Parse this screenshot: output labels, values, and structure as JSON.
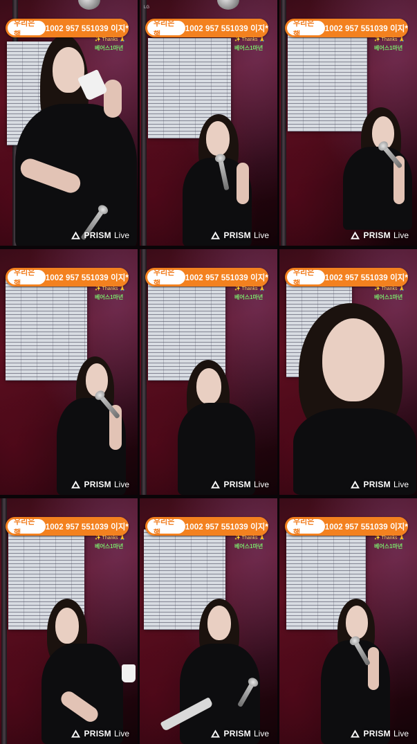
{
  "overlay": {
    "bank_label": "우리은행",
    "account": "1002 957 551039 이지",
    "thanks": "Thanks",
    "subtitle": "베어스1마년",
    "prism_brand": "PRISM",
    "prism_live": "Live"
  },
  "colors": {
    "banner": "#f3811f",
    "bank_text": "#f07a1a",
    "subtitle": "#7be36b",
    "wall": "#5e1222"
  },
  "icons": {
    "prism_logo": "prism-triangle-icon",
    "sparkle": "sparkle-icon"
  },
  "tiles": [
    {
      "id": "tile-1"
    },
    {
      "id": "tile-2"
    },
    {
      "id": "tile-3"
    },
    {
      "id": "tile-4"
    },
    {
      "id": "tile-5"
    },
    {
      "id": "tile-6"
    },
    {
      "id": "tile-7"
    },
    {
      "id": "tile-8"
    },
    {
      "id": "tile-9"
    }
  ]
}
